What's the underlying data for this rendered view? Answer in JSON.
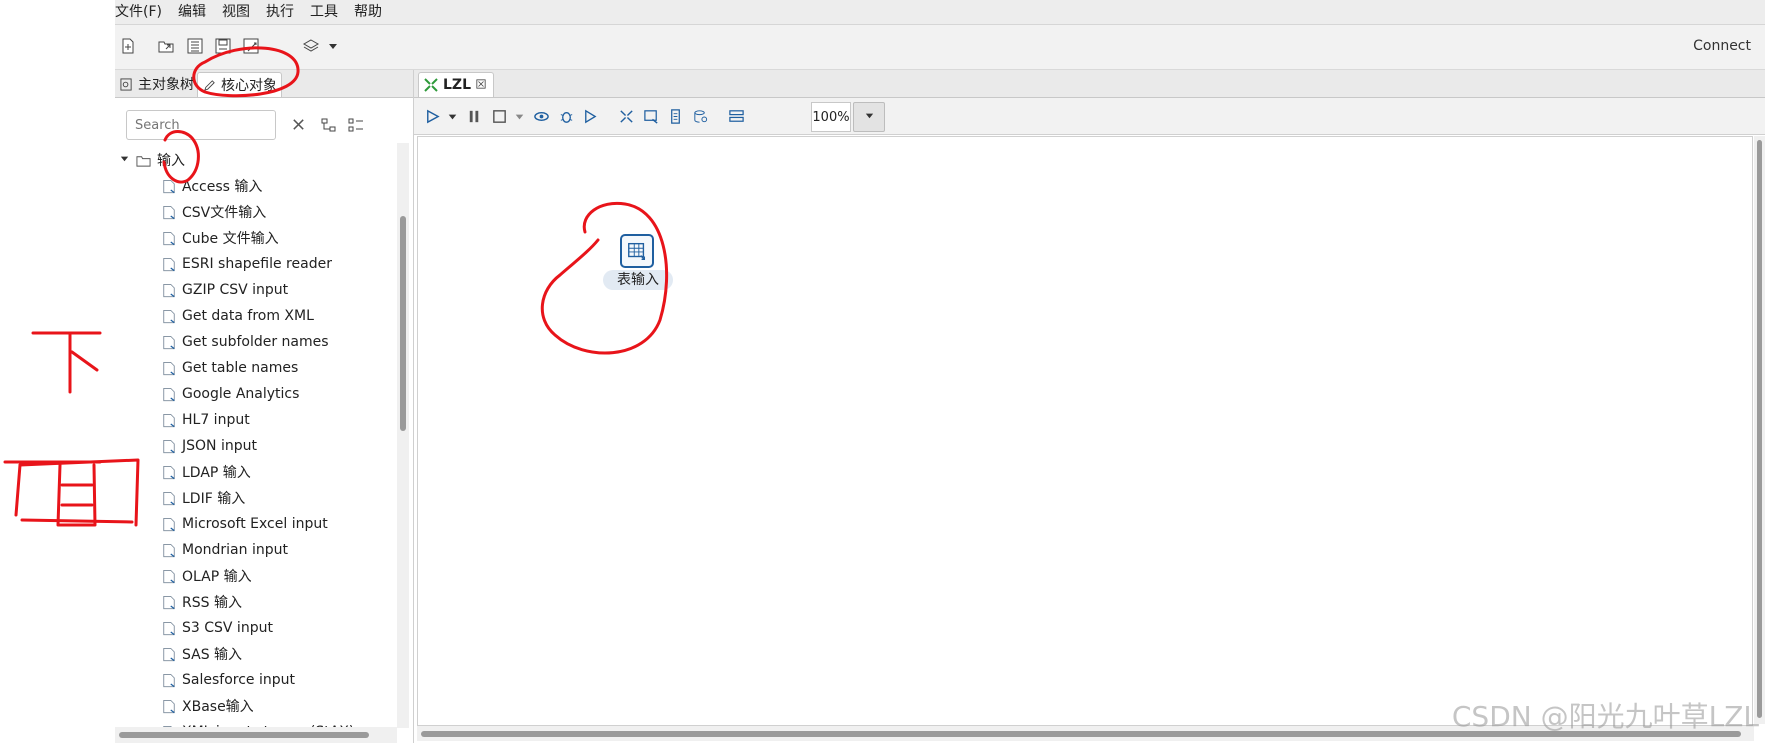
{
  "menu": {
    "items": [
      "文件(F)",
      "编辑",
      "视图",
      "执行",
      "工具",
      "帮助"
    ]
  },
  "toolbar": {
    "connect_label": "Connect",
    "buttons": [
      "new-file-icon",
      "open-folder-icon",
      "explorer-icon",
      "save-icon",
      "save-as-icon",
      "layers-icon",
      "dropdown-arrow-icon"
    ]
  },
  "left_panel": {
    "tabs": [
      {
        "label": "主对象树",
        "active": false
      },
      {
        "label": "核心对象",
        "active": true
      }
    ],
    "search_placeholder": "Search",
    "tree": {
      "folder_label": "输入",
      "expanded": true,
      "items": [
        {
          "label": "Access 输入",
          "icon": "file-input-icon"
        },
        {
          "label": "CSV文件输入",
          "icon": "csv-icon"
        },
        {
          "label": "Cube 文件输入",
          "icon": "cube-icon"
        },
        {
          "label": "ESRI shapefile reader",
          "icon": "map-pin-icon"
        },
        {
          "label": "GZIP CSV input",
          "icon": "gzip-icon"
        },
        {
          "label": "Get data from XML",
          "icon": "xml-icon"
        },
        {
          "label": "Get subfolder names",
          "icon": "folder-tree-icon"
        },
        {
          "label": "Get table names",
          "icon": "table-icon"
        },
        {
          "label": "Google Analytics",
          "icon": "analytics-icon"
        },
        {
          "label": "HL7 input",
          "icon": "hl7-icon"
        },
        {
          "label": "JSON input",
          "icon": "json-icon"
        },
        {
          "label": "LDAP 输入",
          "icon": "shield-icon"
        },
        {
          "label": "LDIF 输入",
          "icon": "shield-icon"
        },
        {
          "label": "Microsoft Excel input",
          "icon": "excel-icon"
        },
        {
          "label": "Mondrian input",
          "icon": "cube-outline-icon"
        },
        {
          "label": "OLAP 输入",
          "icon": "cube-outline-icon"
        },
        {
          "label": "RSS 输入",
          "icon": "rss-icon"
        },
        {
          "label": "S3 CSV input",
          "icon": "s3-icon"
        },
        {
          "label": "SAS 输入",
          "icon": "sas-icon"
        },
        {
          "label": "Salesforce input",
          "icon": "salesforce-icon"
        },
        {
          "label": "XBase输入",
          "icon": "xbase-icon"
        },
        {
          "label": "XML input stream (StAX)",
          "icon": "xml-stream-icon"
        }
      ]
    }
  },
  "editor": {
    "tab_label": "LZL",
    "zoom": "100%",
    "step": {
      "label": "表输入",
      "icon": "table-input-icon"
    }
  },
  "annotations": {
    "handwritten_text": "下面",
    "color": "#e8141a"
  },
  "watermark": "CSDN @阳光九叶草LZL",
  "colors": {
    "accent": "#1f5fa0",
    "annotation": "#e8141a"
  }
}
